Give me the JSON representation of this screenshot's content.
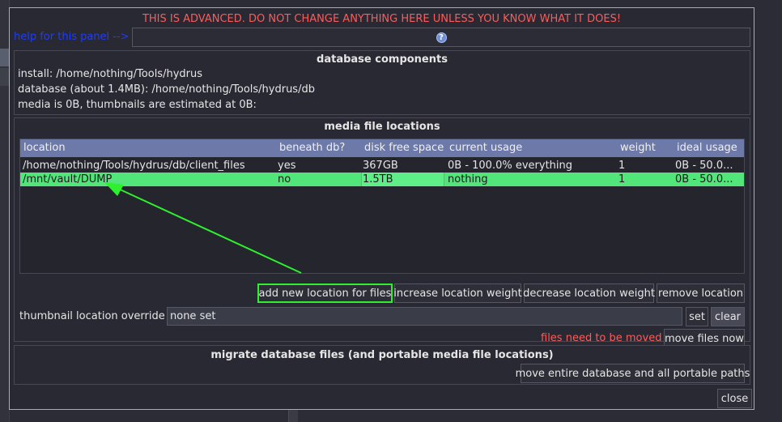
{
  "warning": "THIS IS ADVANCED. DO NOT CHANGE ANYTHING HERE UNLESS YOU KNOW WHAT IT DOES!",
  "help": {
    "link": "help for this panel -->",
    "icon": "question-circle-icon"
  },
  "db_components": {
    "title": "database components",
    "install": "install: /home/nothing/Tools/hydrus",
    "database": "database (about 1.4MB): /home/nothing/Tools/hydrus/db",
    "media": "media is 0B, thumbnails are estimated at 0B:"
  },
  "media_locations": {
    "title": "media file locations",
    "columns": [
      "location",
      "beneath db?",
      "disk free space",
      "current usage",
      "weight",
      "ideal usage"
    ],
    "rows": [
      [
        "/home/nothing/Tools/hydrus/db/client_files",
        "yes",
        "367GB",
        "0B - 100.0% everything",
        "1",
        "0B - 50.0..."
      ],
      [
        "/mnt/vault/DUMP",
        "no",
        "1.5TB",
        "nothing",
        "1",
        "0B - 50.0..."
      ]
    ],
    "buttons": {
      "add": "add new location for files",
      "increase": "increase location weight",
      "decrease": "decrease location weight",
      "remove": "remove location"
    },
    "thumb_override_label": "thumbnail location override",
    "thumb_override_value": "none set",
    "set": "set",
    "clear": "clear",
    "needs_move": "files need to be moved",
    "move_now": "move files now"
  },
  "migrate": {
    "title": "migrate database files (and portable media file locations)",
    "button": "move entire database and all portable paths"
  },
  "close": "close",
  "colors": {
    "accent_border": "#e8a33a",
    "warning": "#ff5a5a",
    "selected_row": "#52e67a",
    "header": "#6d79a8",
    "annotation": "#2ef02e"
  }
}
